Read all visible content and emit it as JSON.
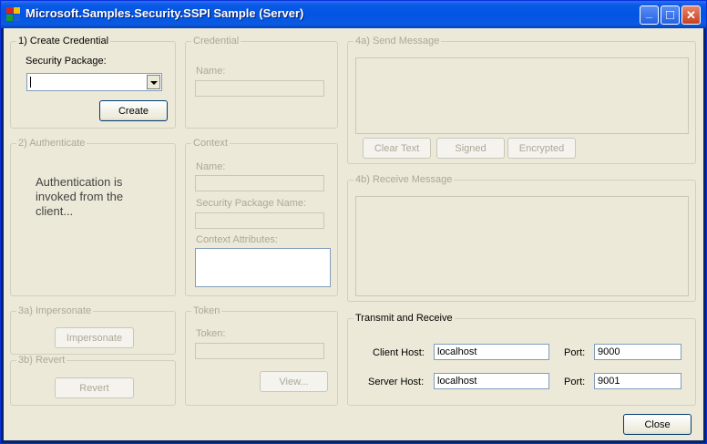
{
  "window": {
    "title": "Microsoft.Samples.Security.SSPI Sample (Server)",
    "minimize_glyph": "_",
    "maximize_glyph": "□",
    "close_glyph": "✕"
  },
  "create_credential": {
    "title": "1) Create Credential",
    "package_label": "Security Package:",
    "package_value": "",
    "create_label": "Create"
  },
  "credential": {
    "title": "Credential",
    "name_label": "Name:",
    "name_value": ""
  },
  "authenticate": {
    "title": "2) Authenticate",
    "message": "Authentication is invoked from the client..."
  },
  "context": {
    "title": "Context",
    "name_label": "Name:",
    "name_value": "",
    "package_name_label": "Security Package Name:",
    "package_name_value": "",
    "attributes_label": "Context Attributes:",
    "attributes_value": ""
  },
  "impersonate": {
    "title": "3a) Impersonate",
    "button_label": "Impersonate"
  },
  "revert": {
    "title": "3b) Revert",
    "button_label": "Revert"
  },
  "token": {
    "title": "Token",
    "token_label": "Token:",
    "token_value": "",
    "view_label": "View..."
  },
  "send_message": {
    "title": "4a) Send Message",
    "text": "",
    "clear_label": "Clear Text",
    "signed_label": "Signed",
    "encrypted_label": "Encrypted"
  },
  "receive_message": {
    "title": "4b) Receive Message",
    "text": ""
  },
  "transmit": {
    "title": "Transmit and Receive",
    "client_host_label": "Client Host:",
    "client_host_value": "localhost",
    "client_port_label": "Port:",
    "client_port_value": "9000",
    "server_host_label": "Server Host:",
    "server_host_value": "localhost",
    "server_port_label": "Port:",
    "server_port_value": "9001"
  },
  "close_label": "Close",
  "colors": {
    "titlebar": "#0154e4",
    "face": "#ece9d8",
    "disabled_text": "#aca899",
    "field_border": "#7f9db9"
  },
  "icons": [
    "app-icon",
    "minimize-icon",
    "maximize-icon",
    "close-icon",
    "chevron-down-icon"
  ]
}
